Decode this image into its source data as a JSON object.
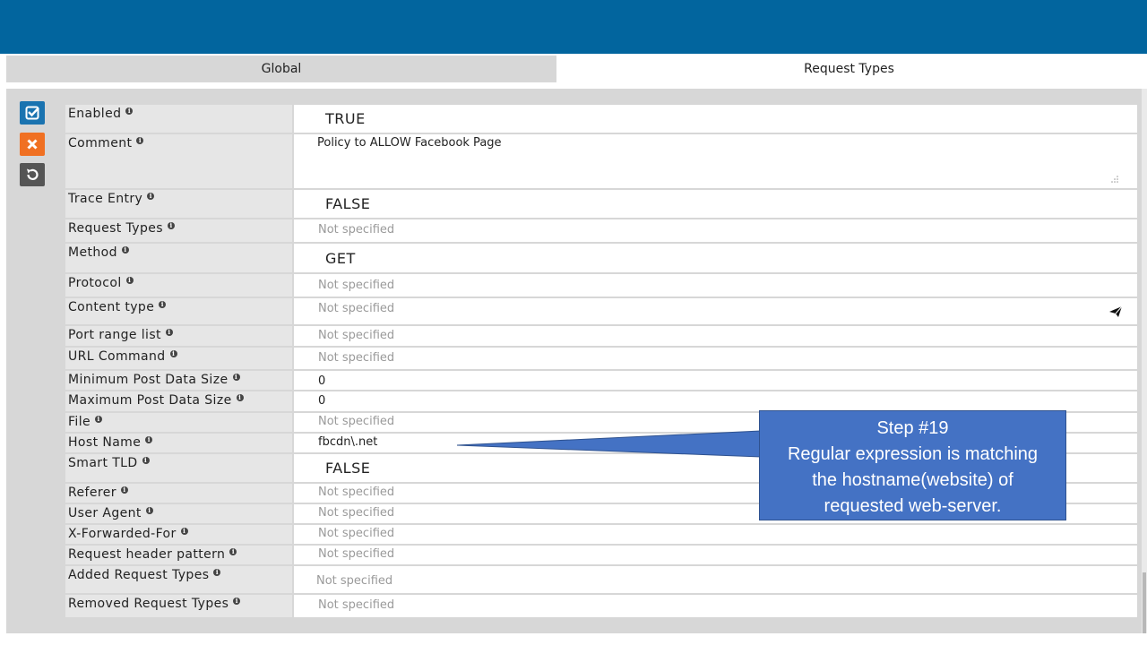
{
  "tabs": [
    {
      "label": "Global"
    },
    {
      "label": "Request Types"
    }
  ],
  "actions": {
    "save_icon": "checkbox-icon",
    "cancel_icon": "close-icon",
    "reset_icon": "undo-icon"
  },
  "fields": [
    {
      "label": "Enabled",
      "value": "TRUE"
    },
    {
      "label": "Comment",
      "value": "Policy to ALLOW Facebook Page"
    },
    {
      "label": "Trace Entry",
      "value": "FALSE"
    },
    {
      "label": "Request Types",
      "value": "Not specified"
    },
    {
      "label": "Method",
      "value": "GET"
    },
    {
      "label": "Protocol",
      "value": "Not specified"
    },
    {
      "label": "Content type",
      "value": "Not specified"
    },
    {
      "label": "Port range list",
      "value": "Not specified"
    },
    {
      "label": "URL Command",
      "value": "Not specified"
    },
    {
      "label": "Minimum Post Data Size",
      "value": "0"
    },
    {
      "label": "Maximum Post Data Size",
      "value": "0"
    },
    {
      "label": "File",
      "value": "Not specified"
    },
    {
      "label": "Host Name",
      "value": "fbcdn\\.net"
    },
    {
      "label": "Smart TLD",
      "value": "FALSE"
    },
    {
      "label": "Referer",
      "value": "Not specified"
    },
    {
      "label": "User Agent",
      "value": "Not specified"
    },
    {
      "label": "X-Forwarded-For",
      "value": "Not specified"
    },
    {
      "label": "Request header pattern",
      "value": "Not specified"
    },
    {
      "label": "Added Request Types",
      "value": "Not specified"
    },
    {
      "label": "Removed Request Types",
      "value": "Not specified"
    }
  ],
  "info_glyph": "i",
  "callout": {
    "lines": [
      "Step #19",
      "Regular expression is matching",
      "the hostname(website) of",
      "requested web-server."
    ]
  },
  "colors": {
    "topbar": "#02659e",
    "callout": "#4472c4",
    "save": "#1a73b0",
    "cancel": "#f07022",
    "reset": "#555555"
  }
}
